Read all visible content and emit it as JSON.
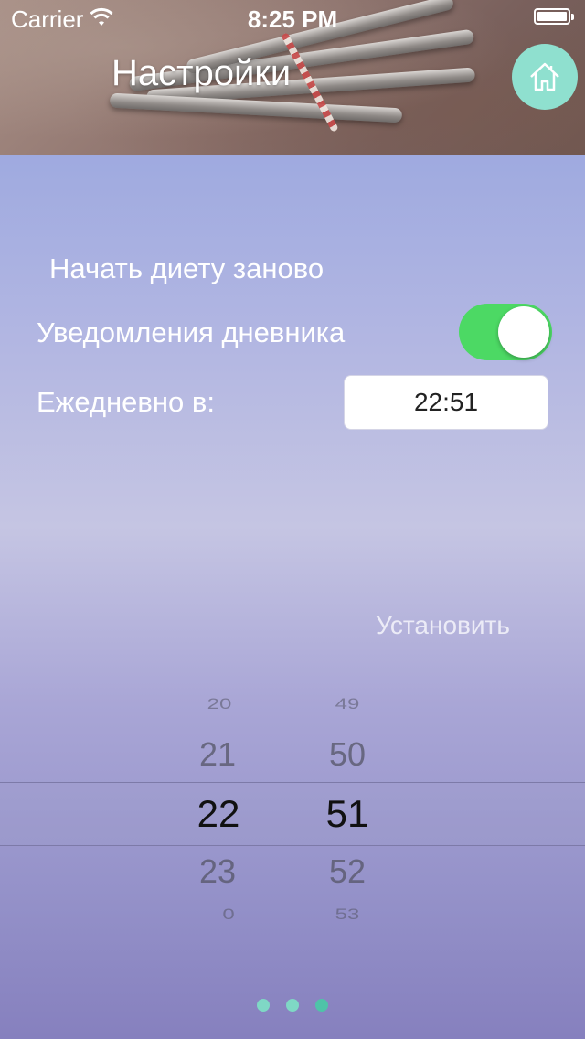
{
  "status_bar": {
    "carrier": "Carrier",
    "time": "8:25 PM"
  },
  "header": {
    "title": "Настройки",
    "home_icon": "home-icon"
  },
  "settings": {
    "restart_label": "Начать диету заново",
    "notifications_label": "Уведомления дневника",
    "notifications_enabled": true,
    "daily_label": "Ежедневно в:",
    "time_value": "22:51",
    "set_label": "Установить"
  },
  "picker": {
    "hours": [
      "20",
      "21",
      "22",
      "23",
      "0"
    ],
    "minutes": [
      "49",
      "50",
      "51",
      "52",
      "53"
    ],
    "selected_hour": "22",
    "selected_minute": "51"
  },
  "page_control": {
    "pages": 3,
    "current": 3
  },
  "colors": {
    "toggle_on": "#4cd964",
    "home_button": "#8fe0cf",
    "dot_color": "#6fd1bc"
  }
}
